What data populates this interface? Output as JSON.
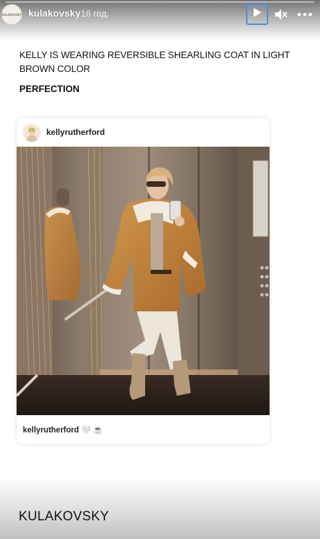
{
  "header": {
    "avatar_text": "KULAKOVSKY",
    "username": "kulakovsky",
    "time": "16 год."
  },
  "icons": {
    "play": "play-icon",
    "mute": "speaker-muted-icon",
    "more": "more-horizontal-icon"
  },
  "caption": {
    "line1": "KELLY IS WEARING REVERSIBLE SHEARLING COAT IN LIGHT BROWN COLOR",
    "line2": "PERFECTION"
  },
  "post": {
    "username": "kellyrutherford",
    "footer_user": "kellyrutherford",
    "footer_emoji": "🤍 ☕"
  },
  "brand": "KULAKOVSKY",
  "colors": {
    "focus_outline": "#4a8fdc",
    "coat": "#c8893f"
  }
}
